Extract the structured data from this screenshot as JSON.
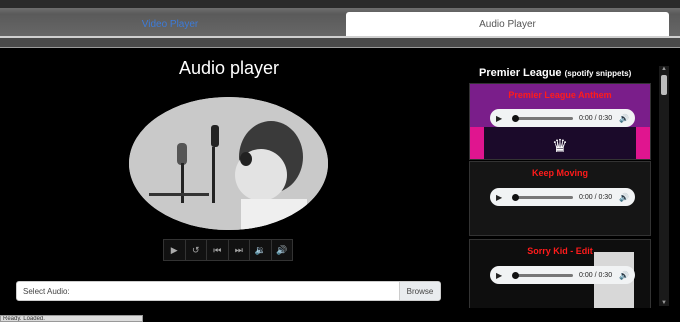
{
  "tabs": [
    {
      "label": "Video Player",
      "active": false
    },
    {
      "label": "Audio Player",
      "active": true
    }
  ],
  "main": {
    "title": "Audio player",
    "controls": [
      "play-icon",
      "replay-icon",
      "skip-back-icon",
      "skip-forward-icon",
      "volume-down-icon",
      "volume-up-icon"
    ],
    "file_input": {
      "label": "Select Audio:",
      "browse": "Browse"
    }
  },
  "sidebar": {
    "heading": "Premier League",
    "heading_suffix": "(spotify snippets)",
    "cards": [
      {
        "title": "Premier League Anthem",
        "time": "0:00 / 0:30",
        "progress": 0
      },
      {
        "title": "Keep Moving",
        "time": "0:00 / 0:30",
        "progress": 0
      },
      {
        "title": "Sorry Kid - Edit",
        "time": "0:00 / 0:30",
        "progress": 0
      }
    ]
  },
  "status_bar": {
    "text": "Ready. Loaded."
  },
  "colors": {
    "accent_tab": "#3d7bd8",
    "song_title": "#ff1b1b",
    "background": "#000000"
  }
}
